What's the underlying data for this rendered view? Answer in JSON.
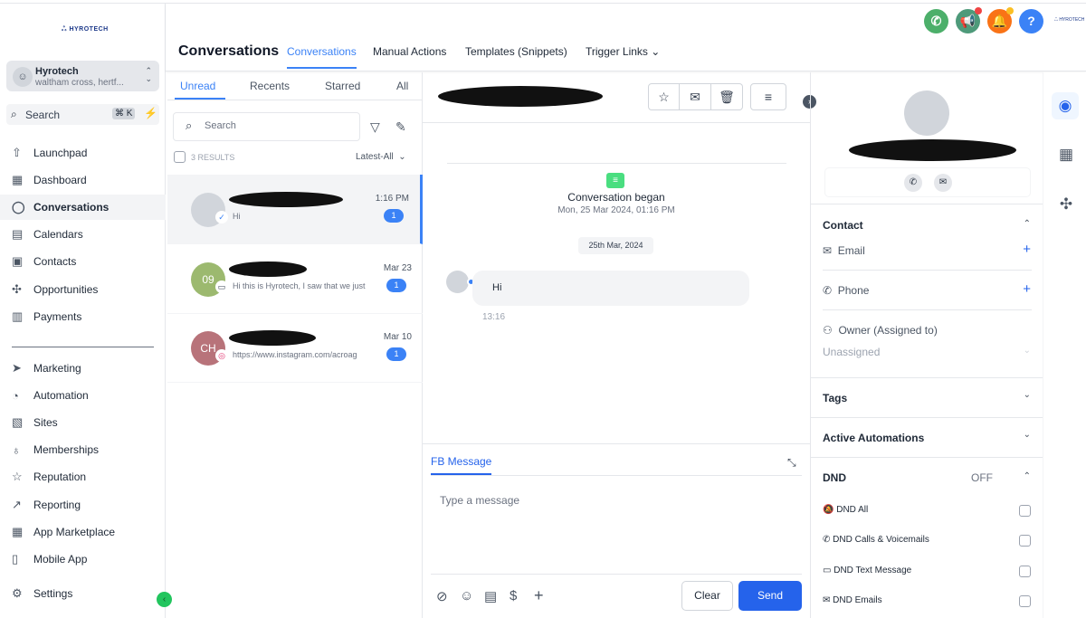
{
  "brand": {
    "logo_text": "HYROTECH"
  },
  "sidebar": {
    "account": {
      "name": "Hyrotech",
      "location": "waltham cross, hertf..."
    },
    "search": {
      "label": "Search",
      "shortcut": "⌘ K"
    },
    "items": [
      {
        "label": "Launchpad",
        "icon": "⇧"
      },
      {
        "label": "Dashboard",
        "icon": "▦"
      },
      {
        "label": "Conversations",
        "icon": "◯"
      },
      {
        "label": "Calendars",
        "icon": "▤"
      },
      {
        "label": "Contacts",
        "icon": "▣"
      },
      {
        "label": "Opportunities",
        "icon": "✣"
      },
      {
        "label": "Payments",
        "icon": "▥"
      }
    ],
    "items2": [
      {
        "label": "Marketing",
        "icon": "➤"
      },
      {
        "label": "Automation",
        "icon": "◔"
      },
      {
        "label": "Sites",
        "icon": "▧"
      },
      {
        "label": "Memberships",
        "icon": "♁"
      },
      {
        "label": "Reputation",
        "icon": "☆"
      },
      {
        "label": "Reporting",
        "icon": "↗"
      },
      {
        "label": "App Marketplace",
        "icon": "▦"
      },
      {
        "label": "Mobile App",
        "icon": "▯"
      }
    ],
    "settings": "Settings"
  },
  "header": {
    "title": "Conversations",
    "tabs": [
      "Conversations",
      "Manual Actions",
      "Templates (Snippets)",
      "Trigger Links"
    ],
    "trigger_chevron": "⌄"
  },
  "list": {
    "tabs": [
      "Unread",
      "Recents",
      "Starred",
      "All"
    ],
    "search_placeholder": "Search",
    "results": "3 RESULTS",
    "sort": "Latest-All",
    "rows": [
      {
        "initials": "",
        "preview": "Hi",
        "time": "1:16 PM",
        "unread": "1",
        "channel": "messenger"
      },
      {
        "initials": "09",
        "preview": "Hi this is Hyrotech, I saw that we just",
        "time": "Mar 23",
        "unread": "1",
        "channel": "sms"
      },
      {
        "initials": "CH",
        "preview": "https://www.instagram.com/acroag",
        "time": "Mar 10",
        "unread": "1",
        "channel": "instagram"
      }
    ]
  },
  "chat": {
    "began": "Conversation began",
    "began_date": "Mon, 25 Mar 2024, 01:16 PM",
    "date_chip": "25th Mar, 2024",
    "message": "Hi",
    "message_time": "13:16",
    "composer_tab": "FB Message",
    "placeholder": "Type a message",
    "clear": "Clear",
    "send": "Send"
  },
  "contact": {
    "section": "Contact",
    "email": "Email",
    "phone": "Phone",
    "owner": "Owner (Assigned to)",
    "owner_value": "Unassigned",
    "tags": "Tags",
    "automations": "Active Automations",
    "dnd": "DND",
    "dnd_state": "OFF",
    "dnd_items": [
      "DND All",
      "DND Calls & Voicemails",
      "DND Text Message",
      "DND Emails"
    ]
  },
  "colors": {
    "accent": "#3b82f6",
    "send": "#2563eb"
  }
}
